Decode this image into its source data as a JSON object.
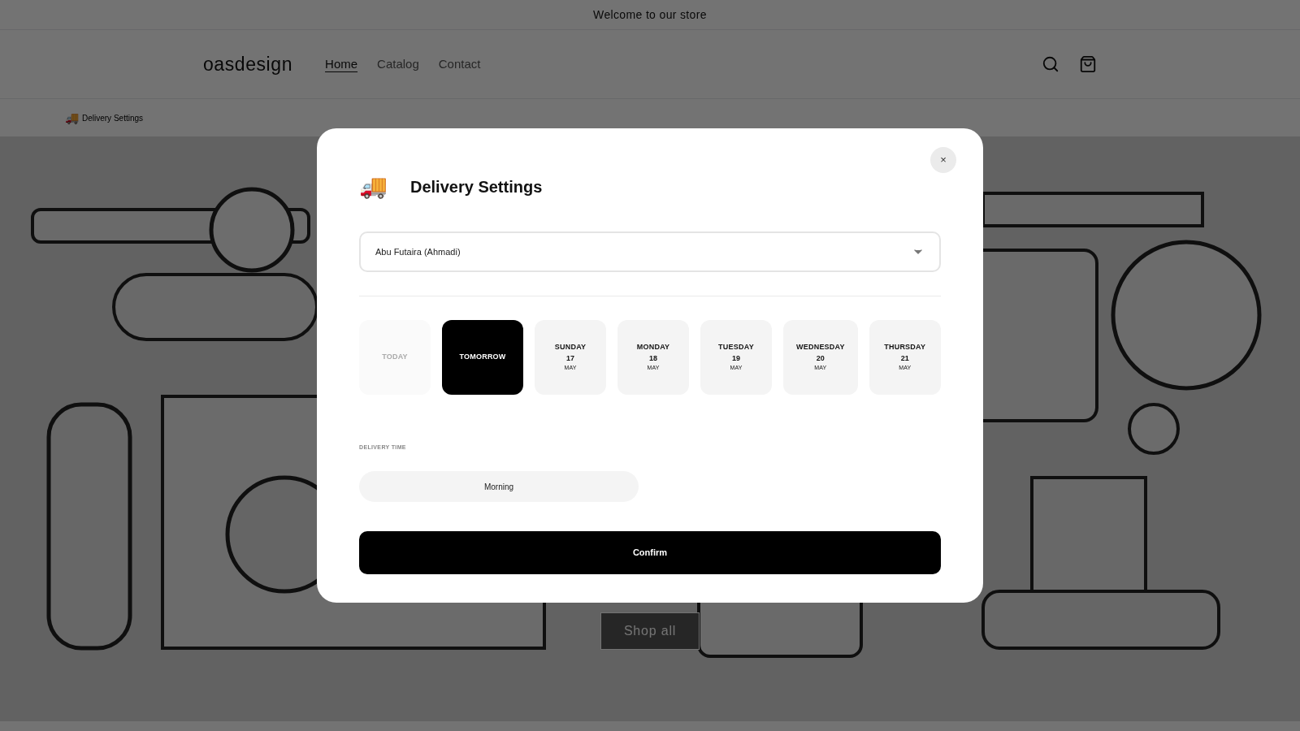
{
  "announcement": "Welcome to our store",
  "header": {
    "logo": "oasdesign",
    "nav": [
      {
        "label": "Home",
        "selected": true
      },
      {
        "label": "Catalog",
        "selected": false
      },
      {
        "label": "Contact",
        "selected": false
      }
    ]
  },
  "delivery_strip": {
    "icon": "🚚",
    "label": "Delivery Settings"
  },
  "hero": {
    "kind": "picture",
    "button": "Shop all"
  },
  "modal": {
    "icon": "🚚",
    "title": "Delivery Settings",
    "close": "×",
    "location": {
      "value": "Abu Futaira (Ahmadi)"
    },
    "days": [
      {
        "label": "TODAY",
        "disabled": true,
        "selected": false
      },
      {
        "label": "TOMORROW",
        "disabled": false,
        "selected": true
      },
      {
        "label": "SUNDAY",
        "day": "17",
        "month": "MAY",
        "disabled": false,
        "selected": false
      },
      {
        "label": "MONDAY",
        "day": "18",
        "month": "MAY",
        "disabled": false,
        "selected": false
      },
      {
        "label": "TUESDAY",
        "day": "19",
        "month": "MAY",
        "disabled": false,
        "selected": false
      },
      {
        "label": "WEDNESDAY",
        "day": "20",
        "month": "MAY",
        "disabled": false,
        "selected": false
      },
      {
        "label": "THURSDAY",
        "day": "21",
        "month": "MAY",
        "disabled": false,
        "selected": false
      }
    ],
    "time_label": "DELIVERY TIME",
    "times": [
      {
        "label": "Morning",
        "selected": false
      }
    ],
    "confirm": "Confirm"
  }
}
